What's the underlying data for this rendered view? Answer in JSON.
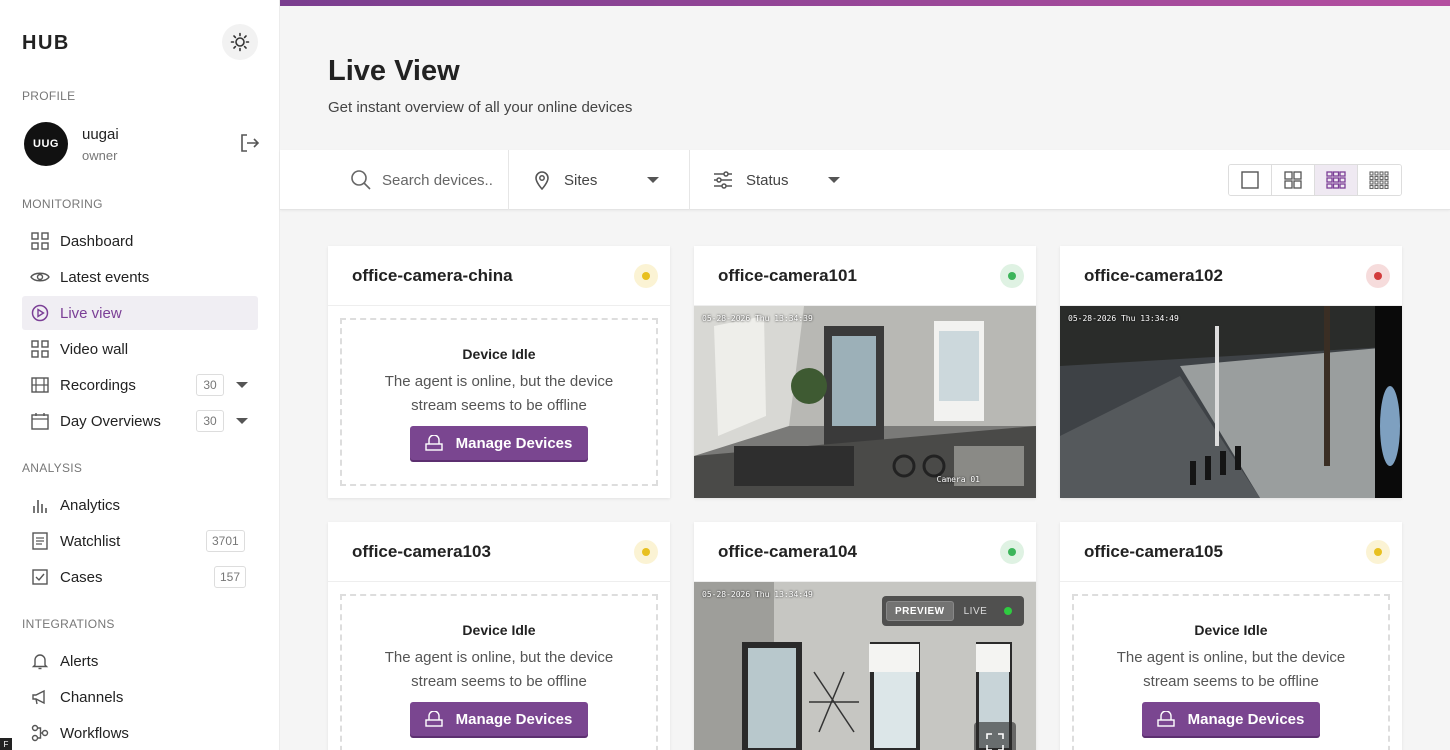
{
  "app": {
    "logo": "HUB"
  },
  "profile": {
    "section": "PROFILE",
    "initials": "UUG",
    "name": "uugai",
    "role": "owner"
  },
  "monitoring": {
    "section": "MONITORING",
    "items": [
      {
        "label": "Dashboard"
      },
      {
        "label": "Latest events"
      },
      {
        "label": "Live view"
      },
      {
        "label": "Video wall"
      },
      {
        "label": "Recordings",
        "badge": "30"
      },
      {
        "label": "Day Overviews",
        "badge": "30"
      }
    ]
  },
  "analysis": {
    "section": "ANALYSIS",
    "items": [
      {
        "label": "Analytics"
      },
      {
        "label": "Watchlist",
        "badge": "3701"
      },
      {
        "label": "Cases",
        "badge": "157"
      }
    ]
  },
  "integrations": {
    "section": "INTEGRATIONS",
    "items": [
      {
        "label": "Alerts"
      },
      {
        "label": "Channels"
      },
      {
        "label": "Workflows"
      }
    ]
  },
  "header": {
    "title": "Live View",
    "subtitle": "Get instant overview of all your online devices"
  },
  "filters": {
    "search_placeholder": "Search devices...",
    "sites": "Sites",
    "status": "Status"
  },
  "colors": {
    "accent": "#7a4690",
    "status_idle": "#e8c020",
    "status_online": "#3cb55a",
    "status_offline": "#d23c3c"
  },
  "idle": {
    "title": "Device Idle",
    "text": "The agent is online, but the device stream seems to be offline",
    "button": "Manage Devices"
  },
  "cameras": [
    {
      "name": "office-camera-china",
      "status": "idle"
    },
    {
      "name": "office-camera101",
      "status": "online",
      "timestamp": "05-28-2026 Thu 13:34:39",
      "label": "Camera 01"
    },
    {
      "name": "office-camera102",
      "status": "offline",
      "timestamp": "05-28-2026 Thu 13:34:49"
    },
    {
      "name": "office-camera103",
      "status": "idle"
    },
    {
      "name": "office-camera104",
      "status": "online",
      "timestamp": "05-28-2026 Thu 13:34:49",
      "mode_preview": "PREVIEW",
      "mode_live": "LIVE"
    },
    {
      "name": "office-camera105",
      "status": "idle"
    }
  ],
  "corner_glyph": "F"
}
